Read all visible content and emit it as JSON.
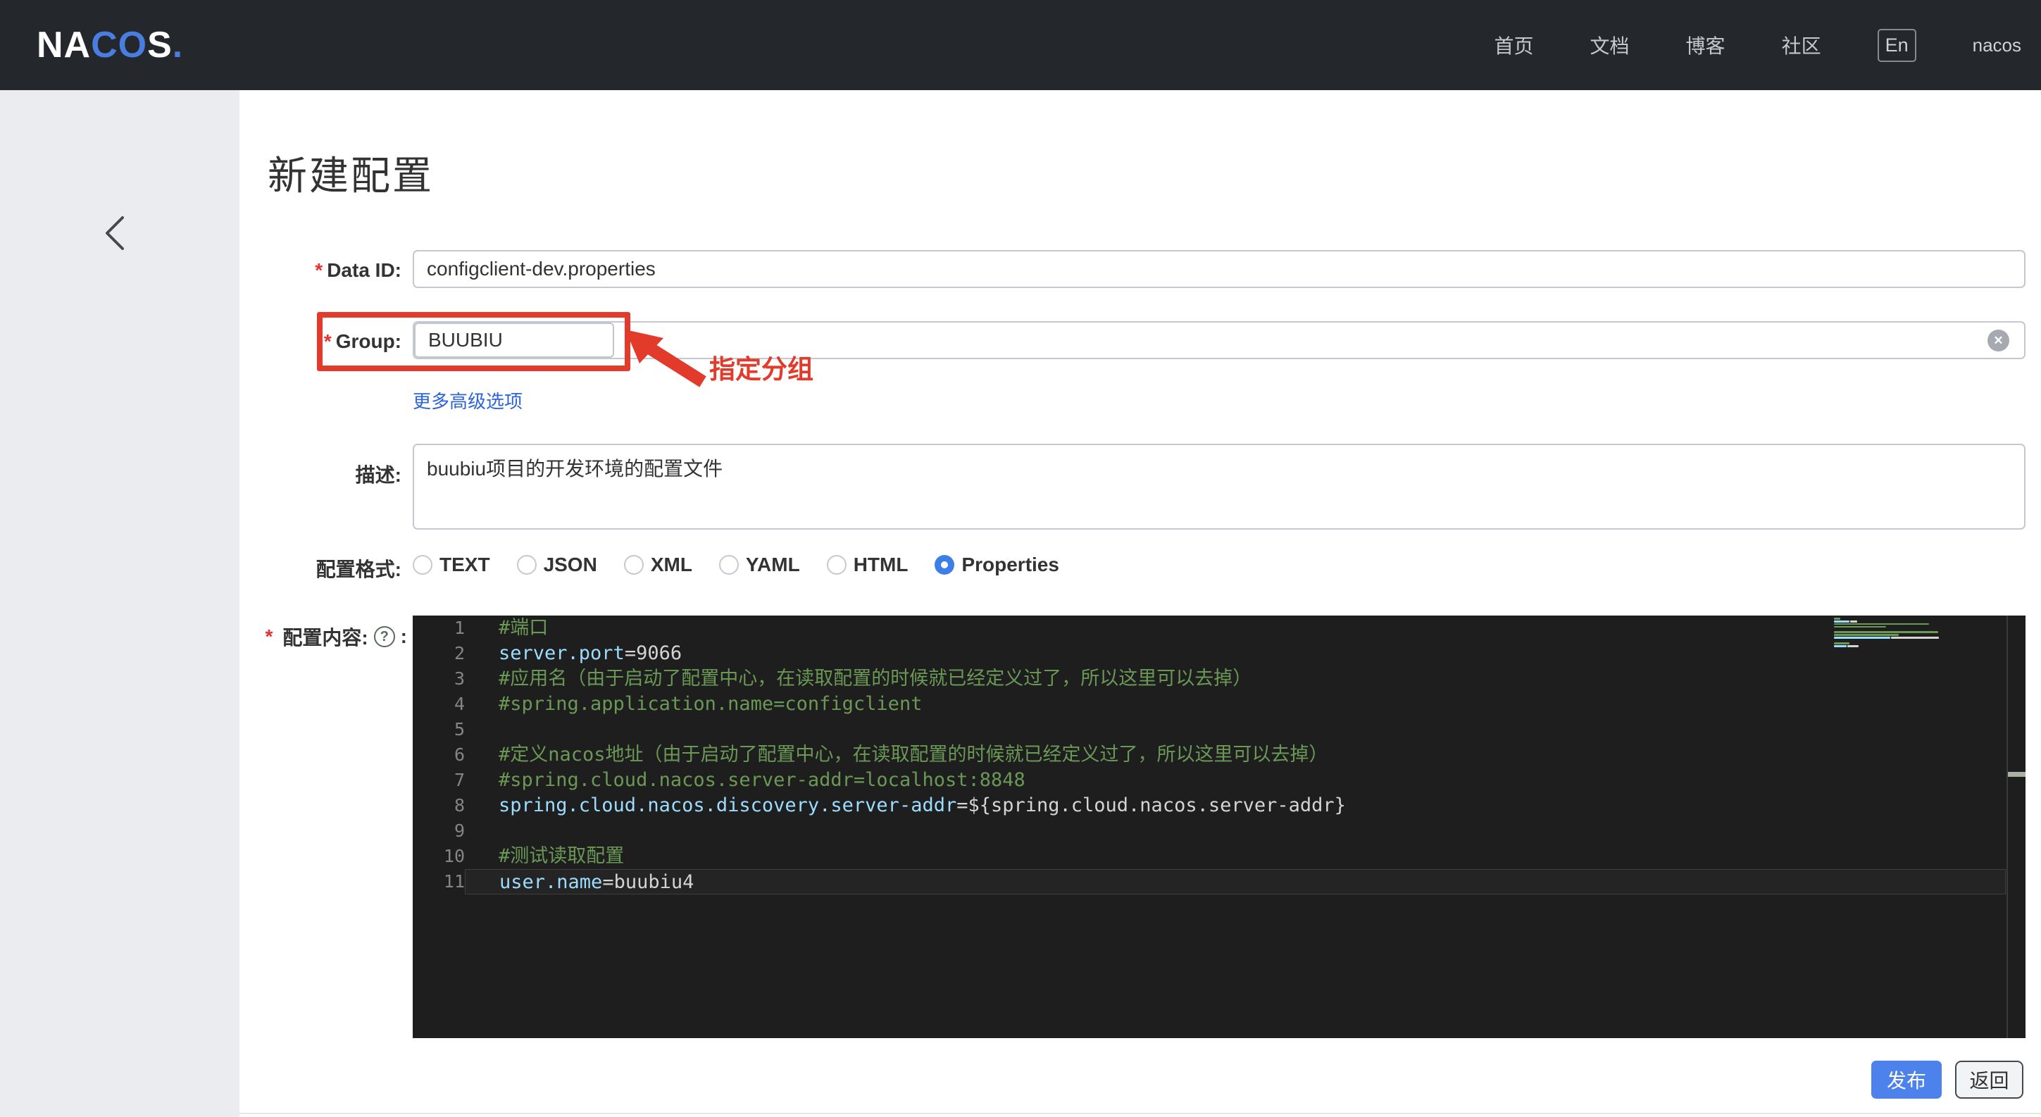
{
  "navbar": {
    "logo": {
      "white1": "NA",
      "blue1": "CO",
      "white2": "S",
      "dot": "."
    },
    "items": [
      "首页",
      "文档",
      "博客",
      "社区"
    ],
    "lang": "En",
    "username": "nacos"
  },
  "page": {
    "title": "新建配置"
  },
  "form": {
    "required_mark": "*",
    "data_id": {
      "label": "Data ID:",
      "value": "configclient-dev.properties"
    },
    "group": {
      "label": "Group:",
      "value": "BUUBIU"
    },
    "annotation": {
      "text": "指定分组",
      "color": "#e23a2b"
    },
    "more_options_link": "更多高级选项",
    "description": {
      "label": "描述:",
      "value": "buubiu项目的开发环境的配置文件"
    },
    "format": {
      "label": "配置格式:",
      "options": [
        "TEXT",
        "JSON",
        "XML",
        "YAML",
        "HTML",
        "Properties"
      ],
      "selected": "Properties"
    },
    "content": {
      "label": "配置内容:",
      "help": "?",
      "suffix": ":"
    },
    "clear_icon_glyph": "✕"
  },
  "editor": {
    "theme": {
      "background": "#1e1e1e",
      "comment": "#6a9955",
      "key": "#9cdcfe",
      "value": "#d4d4d4",
      "line_number": "#858585"
    },
    "lines": [
      {
        "n": "1",
        "segs": [
          {
            "t": "#端口",
            "y": "c"
          }
        ]
      },
      {
        "n": "2",
        "segs": [
          {
            "t": "server.port",
            "y": "k"
          },
          {
            "t": "=9066",
            "y": "v"
          }
        ]
      },
      {
        "n": "3",
        "segs": [
          {
            "t": "#应用名（由于启动了配置中心，在读取配置的时候就已经定义过了，所以这里可以去掉）",
            "y": "c"
          }
        ]
      },
      {
        "n": "4",
        "segs": [
          {
            "t": "#spring.application.name=configclient",
            "y": "c"
          }
        ]
      },
      {
        "n": "5",
        "segs": []
      },
      {
        "n": "6",
        "segs": [
          {
            "t": "#定义nacos地址（由于启动了配置中心，在读取配置的时候就已经定义过了，所以这里可以去掉）",
            "y": "c"
          }
        ]
      },
      {
        "n": "7",
        "segs": [
          {
            "t": "#spring.cloud.nacos.server-addr=localhost:8848",
            "y": "c"
          }
        ]
      },
      {
        "n": "8",
        "segs": [
          {
            "t": "spring.cloud.nacos.discovery.server-addr",
            "y": "k"
          },
          {
            "t": "=${spring.cloud.nacos.server-addr}",
            "y": "v"
          }
        ]
      },
      {
        "n": "9",
        "segs": []
      },
      {
        "n": "10",
        "segs": [
          {
            "t": "#测试读取配置",
            "y": "c"
          }
        ]
      },
      {
        "n": "11",
        "segs": [
          {
            "t": "user.name",
            "y": "k"
          },
          {
            "t": "=buubiu4",
            "y": "v"
          }
        ],
        "current": true
      }
    ]
  },
  "actions": {
    "publish": "发布",
    "back": "返回"
  },
  "colors": {
    "navbar_bg": "#24272b",
    "brand_blue": "#4a7de0",
    "sidebar_bg": "#eaecf0",
    "annotation_red": "#e23a2b",
    "link_blue": "#2d64dc",
    "radio_blue": "#3d7fe8",
    "publish_blue": "#4d82ec"
  }
}
